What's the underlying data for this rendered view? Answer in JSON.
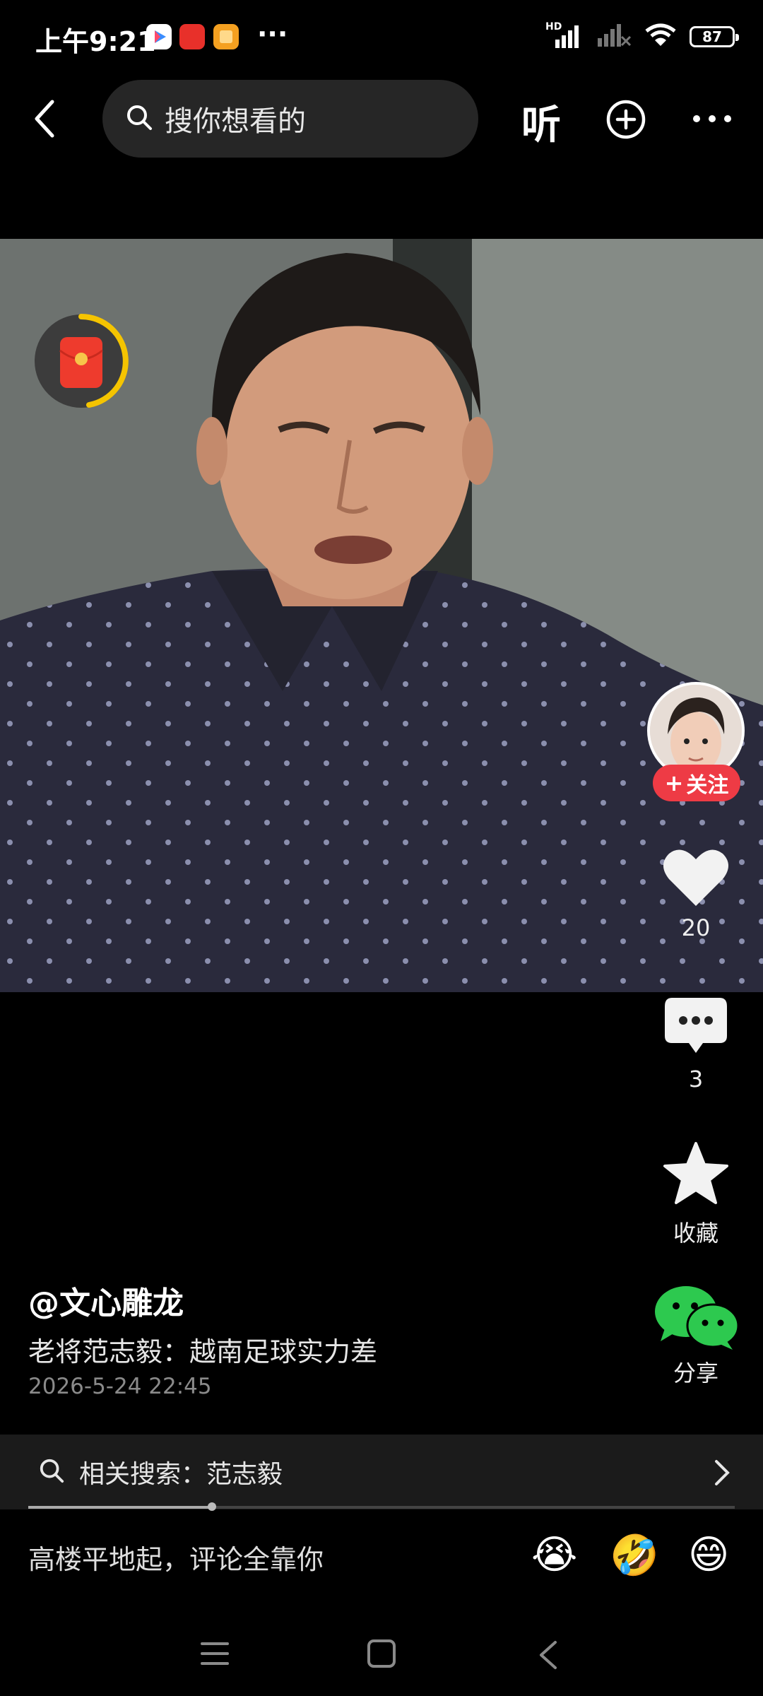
{
  "status_bar": {
    "time": "上午9:21",
    "more": "···",
    "network_label": "HD",
    "battery": "87"
  },
  "top_bar": {
    "search_placeholder": "搜你想看的",
    "listen_label": "听",
    "icons": [
      "back-arrow-icon",
      "search-icon",
      "plus-circle-icon",
      "more-icon"
    ]
  },
  "side_actions": {
    "follow_label": "关注",
    "like_count": "20",
    "comment_count": "3",
    "favorite_label": "收藏",
    "share_label": "分享"
  },
  "video_info": {
    "author": "@文心雕龙",
    "caption": "老将范志毅：越南足球实力差",
    "timestamp": "2026-5-24 22:45"
  },
  "related_search": {
    "label": "相关搜索：范志毅"
  },
  "progress": {
    "fraction": 0.26
  },
  "comment_bar": {
    "placeholder": "高楼平地起，评论全靠你",
    "emojis": [
      "😭",
      "🤣",
      "😄"
    ]
  },
  "colors": {
    "accent_red": "#ee3b45",
    "wechat_green": "#2dc94f",
    "background": "#000000"
  }
}
